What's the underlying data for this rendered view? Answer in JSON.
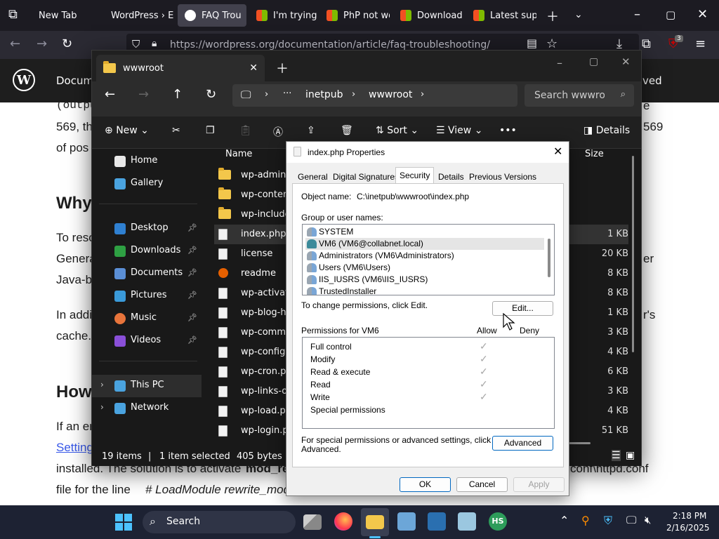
{
  "browser": {
    "tabs": [
      {
        "label": "New Tab"
      },
      {
        "label": "WordPress › Err"
      },
      {
        "label": "FAQ Trou"
      },
      {
        "label": "I'm trying t"
      },
      {
        "label": "PhP not wo"
      },
      {
        "label": "Download"
      },
      {
        "label": "Latest supp"
      }
    ],
    "url": "https://wordpress.org/documentation/article/faq-troubleshooting/",
    "extension_badge": "3"
  },
  "webpage": {
    "nav_left": "Docume",
    "nav_right": "ved",
    "lines": [
      "(outpu",
      "569, th",
      "of pos",
      "To reso",
      "Genera",
      "Java-b",
      "In addi",
      "cache.",
      "If an er",
      "Setting",
      "installed. The solution is to activate",
      "file for the line",
      "e",
      "569",
      "er",
      "r's",
      "conf\\httpd.conf"
    ],
    "heading1": "Why",
    "heading2": "How",
    "bold_text": "mod_re",
    "italic_text": "# LoadModule rewrite_modu"
  },
  "explorer": {
    "tab_title": "wwwroot",
    "breadcrumb": [
      "inetpub",
      "wwwroot"
    ],
    "search_placeholder": "Search wwwroot",
    "cmd": {
      "new": "New",
      "sort": "Sort",
      "view": "View",
      "more": "•••",
      "details": "Details"
    },
    "col_name": "Name",
    "col_size": "Size",
    "nav": [
      {
        "label": "Home"
      },
      {
        "label": "Gallery"
      },
      {
        "label": "Desktop"
      },
      {
        "label": "Downloads"
      },
      {
        "label": "Documents"
      },
      {
        "label": "Pictures"
      },
      {
        "label": "Music"
      },
      {
        "label": "Videos"
      },
      {
        "label": "This PC"
      },
      {
        "label": "Network"
      }
    ],
    "files": [
      {
        "name": "wp-admin",
        "size": ""
      },
      {
        "name": "wp-content",
        "size": ""
      },
      {
        "name": "wp-includes",
        "size": ""
      },
      {
        "name": "index.php",
        "size": "1 KB"
      },
      {
        "name": "license",
        "size": "20 KB"
      },
      {
        "name": "readme",
        "size": "8 KB"
      },
      {
        "name": "wp-activate.php",
        "size": "8 KB"
      },
      {
        "name": "wp-blog-header.php",
        "size": "1 KB"
      },
      {
        "name": "wp-comments-post.php",
        "size": "3 KB"
      },
      {
        "name": "wp-config.php",
        "size": "4 KB"
      },
      {
        "name": "wp-cron.php",
        "size": "6 KB"
      },
      {
        "name": "wp-links-opml.php",
        "size": "3 KB"
      },
      {
        "name": "wp-load.php",
        "size": "4 KB"
      },
      {
        "name": "wp-login.php",
        "size": "51 KB"
      }
    ],
    "status": {
      "items": "19 items",
      "selected": "1 item selected",
      "size": "405 bytes"
    }
  },
  "properties": {
    "title": "index.php Properties",
    "tabs": [
      "General",
      "Digital Signatures",
      "Security",
      "Details",
      "Previous Versions"
    ],
    "object_name_label": "Object name:",
    "object_name_value": "C:\\inetpub\\wwwroot\\index.php",
    "group_label": "Group or user names:",
    "users": [
      "SYSTEM",
      "VM6 (VM6@collabnet.local)",
      "Administrators (VM6\\Administrators)",
      "Users (VM6\\Users)",
      "IIS_IUSRS (VM6\\IIS_IUSRS)",
      "TrustedInstaller"
    ],
    "change_text": "To change permissions, click Edit.",
    "edit_button": "Edit...",
    "perm_label": "Permissions for VM6",
    "allow_label": "Allow",
    "deny_label": "Deny",
    "permissions": [
      {
        "name": "Full control",
        "allow": "✓"
      },
      {
        "name": "Modify",
        "allow": "✓"
      },
      {
        "name": "Read & execute",
        "allow": "✓"
      },
      {
        "name": "Read",
        "allow": "✓"
      },
      {
        "name": "Write",
        "allow": "✓"
      },
      {
        "name": "Special permissions",
        "allow": ""
      }
    ],
    "special_text_1": "For special permissions or advanced settings, click",
    "special_text_2": "Advanced.",
    "advanced_button": "Advanced",
    "ok": "OK",
    "cancel": "Cancel",
    "apply": "Apply"
  },
  "taskbar": {
    "search": "Search",
    "time": "2:18 PM",
    "date": "2/16/2025",
    "hs_label": "HS"
  }
}
